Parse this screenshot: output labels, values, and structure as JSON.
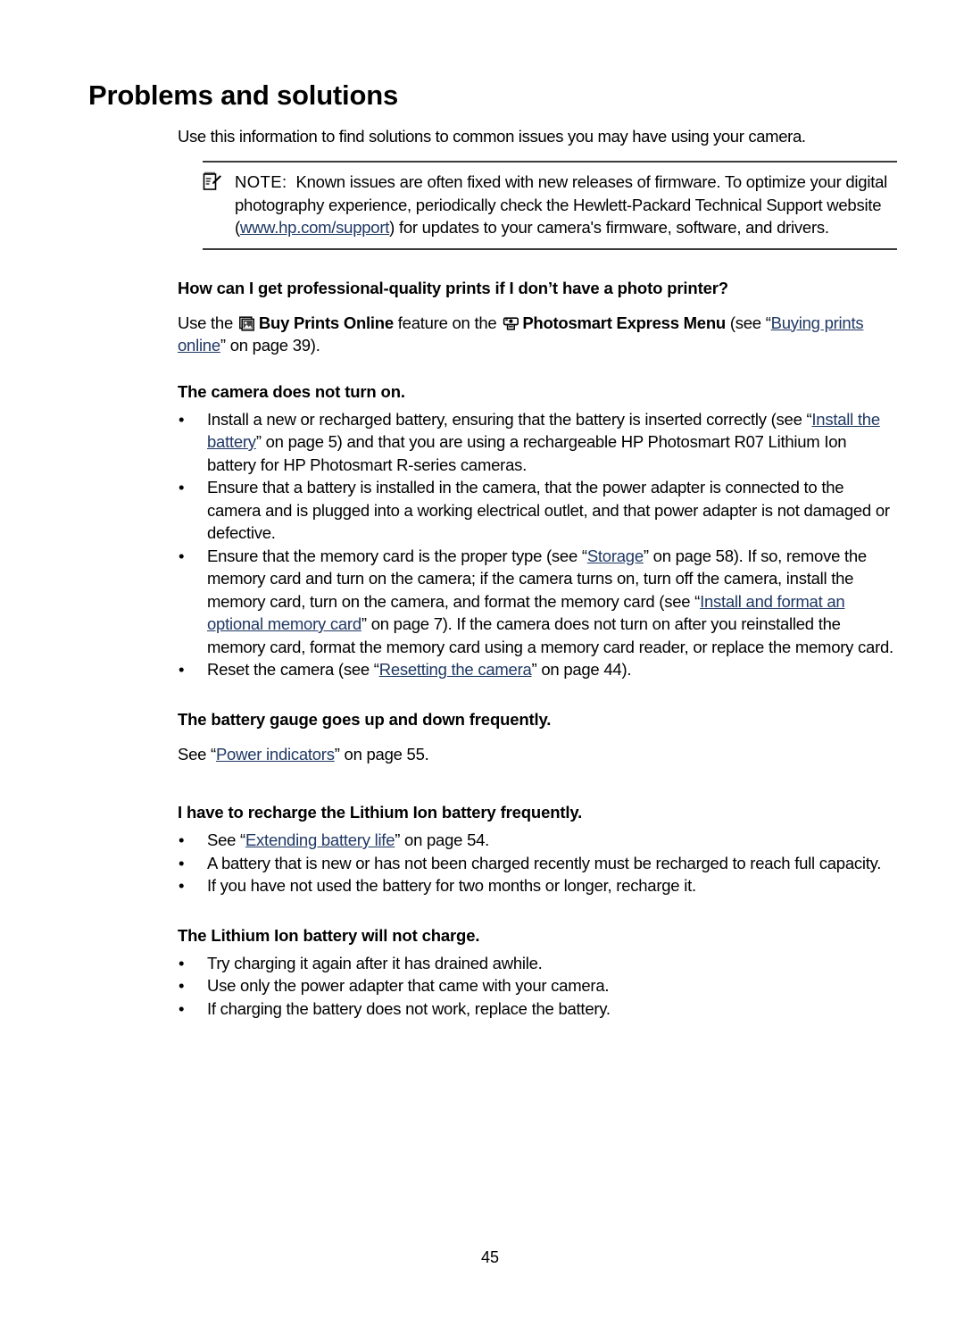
{
  "document": {
    "title": "Problems and solutions",
    "page_number": "45",
    "intro": "Use this information to find solutions to common issues you may have using your camera.",
    "link_color": "#1f3864"
  },
  "note": {
    "icon": "note-pencil-icon",
    "label": "NOTE:",
    "text_before_link": "Known issues are often fixed with new releases of firmware. To optimize your digital photography experience, periodically check the Hewlett-Packard Technical Support website (",
    "link": "www.hp.com/support",
    "text_after_link": ") for updates to your camera's firmware, software, and drivers."
  },
  "sections": [
    {
      "heading": "How can I get professional-quality prints if I don’t have a photo printer?",
      "paragraph": {
        "p1": "Use the",
        "icon1": "buy-prints-online-icon",
        "bold1": "Buy Prints Online",
        "p2": "feature on the",
        "icon2": "photosmart-express-icon",
        "bold2": "Photosmart Express Menu",
        "p3": "(see “",
        "link": "Buying prints online",
        "p4": "” on page 39)."
      }
    },
    {
      "heading": "The camera does not turn on.",
      "bullets": [
        {
          "pre": "Install a new or recharged battery, ensuring that the battery is inserted correctly (see “",
          "link": "Install the battery",
          "post": "” on page 5) and that you are using a rechargeable HP Photosmart R07 Lithium Ion battery for HP Photosmart R-series cameras."
        },
        {
          "pre": "Ensure that a battery is installed in the camera, that the power adapter is connected to the camera and is plugged into a working electrical outlet, and that power adapter is not damaged or defective."
        },
        {
          "pre": "Ensure that the memory card is the proper type (see “",
          "link": "Storage",
          "mid": "” on page 58). If so, remove the memory card and turn on the camera; if the camera turns on, turn off the camera, install the memory card, turn on the camera, and format the memory card (see “",
          "link2": "Install and format an optional memory card",
          "post": "” on page 7). If the camera does not turn on after you reinstalled the memory card, format the memory card using a memory card reader, or replace the memory card."
        },
        {
          "pre": "Reset the camera (see “",
          "link": "Resetting the camera",
          "post": "” on page 44)."
        }
      ]
    },
    {
      "heading": "The battery gauge goes up and down frequently.",
      "paragraph": {
        "pre": "See “",
        "link": "Power indicators",
        "post": "” on page 55."
      }
    },
    {
      "heading": "I have to recharge the Lithium Ion battery frequently.",
      "bullets": [
        {
          "pre": "See “",
          "link": "Extending battery life",
          "post": "” on page 54."
        },
        {
          "pre": "A battery that is new or has not been charged recently must be recharged to reach full capacity."
        },
        {
          "pre": "If you have not used the battery for two months or longer, recharge it."
        }
      ]
    },
    {
      "heading": "The Lithium Ion battery will not charge.",
      "bullets": [
        {
          "pre": "Try charging it again after it has drained awhile."
        },
        {
          "pre": "Use only the power adapter that came with your camera."
        },
        {
          "pre": "If charging the battery does not work, replace the battery."
        }
      ]
    }
  ],
  "symbols": {
    "bullet": "•"
  }
}
